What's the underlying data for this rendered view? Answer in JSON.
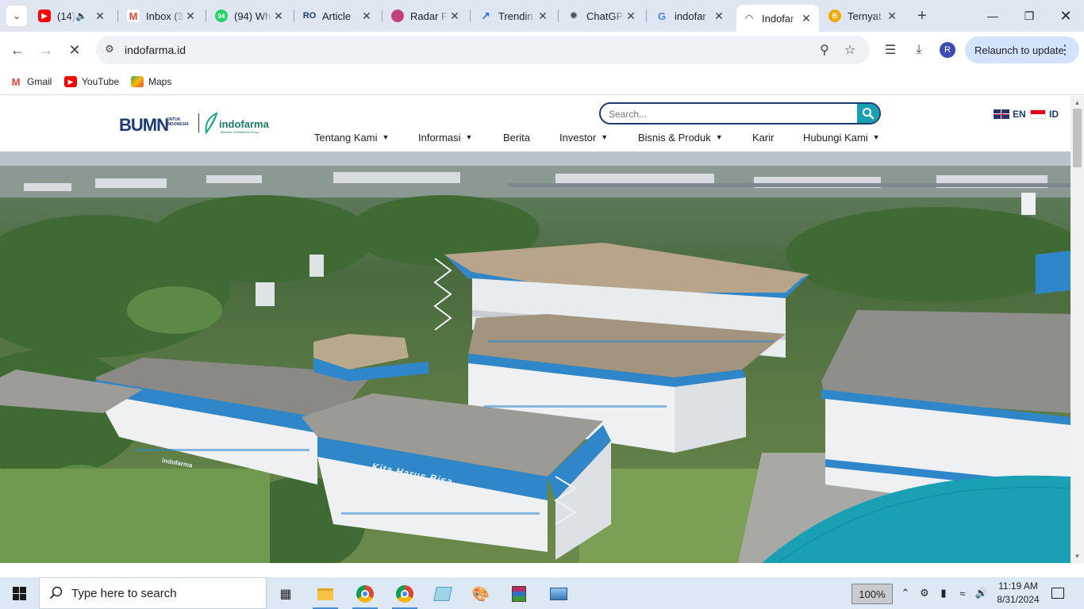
{
  "browser": {
    "tabs": [
      {
        "title": "(14)",
        "favicon": "youtube-icon",
        "color": "#ff0000",
        "audio": true
      },
      {
        "title": "Inbox (3",
        "favicon": "gmail-icon",
        "color": "#ea4335"
      },
      {
        "title": "(94) Wh",
        "favicon": "whatsapp-icon",
        "color": "#25d366",
        "badge": "94"
      },
      {
        "title": "Article",
        "favicon": "ro-icon",
        "color": "#1f3b73",
        "badge": "RO"
      },
      {
        "title": "Radar F",
        "favicon": "radar-icon",
        "color": "#c04080"
      },
      {
        "title": "Trendin",
        "favicon": "trending-icon",
        "color": "#1a73e8"
      },
      {
        "title": "ChatGP",
        "favicon": "chatgpt-icon",
        "color": "#555555"
      },
      {
        "title": "indofar",
        "favicon": "google-icon",
        "color": "#4285f4"
      },
      {
        "title": "Indofar",
        "favicon": "indofarma-icon",
        "color": "#1a7a6a",
        "active": true
      },
      {
        "title": "Ternyat",
        "favicon": "bitcoin-icon",
        "color": "#f2a900"
      }
    ],
    "url": "indofarma.id",
    "relaunch_label": "Relaunch to update",
    "profile_initial": "R",
    "bookmarks": [
      {
        "label": "Gmail",
        "icon": "gmail-icon"
      },
      {
        "label": "YouTube",
        "icon": "youtube-icon"
      },
      {
        "label": "Maps",
        "icon": "maps-icon"
      }
    ]
  },
  "site": {
    "logo": {
      "bumn": "BUMN",
      "bumn_sub": "UNTUK INDONESIA",
      "brand": "indofarma",
      "brand_sub": "Member of Biofarma Group"
    },
    "search_placeholder": "Search...",
    "languages": [
      {
        "code": "EN"
      },
      {
        "code": "ID"
      }
    ],
    "nav": [
      {
        "label": "Tentang Kami",
        "dropdown": true
      },
      {
        "label": "Informasi",
        "dropdown": true
      },
      {
        "label": "Berita",
        "dropdown": false
      },
      {
        "label": "Investor",
        "dropdown": true
      },
      {
        "label": "Bisnis & Produk",
        "dropdown": true
      },
      {
        "label": "Karir",
        "dropdown": false
      },
      {
        "label": "Hubungi Kami",
        "dropdown": true
      }
    ],
    "hero": {
      "building_sign": "Kita Harus Bisa",
      "wall_logo": "indofarma"
    }
  },
  "taskbar": {
    "search_placeholder": "Type here to search",
    "zoom": "100%",
    "time": "11:19 AM",
    "date": "8/31/2024"
  }
}
